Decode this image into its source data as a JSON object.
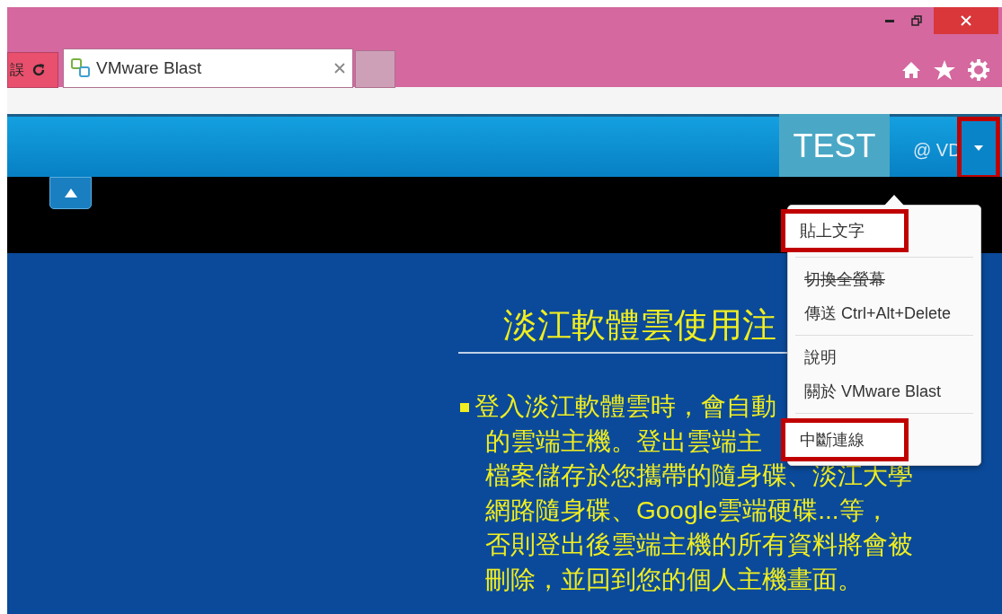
{
  "browser": {
    "address_fragment": "誤",
    "tabs": [
      {
        "title": "VMware Blast",
        "selected": true
      }
    ]
  },
  "toolbar": {
    "user": "TEST",
    "host": "@ VD",
    "dropdown_highlighted": true
  },
  "menu": {
    "groups": [
      [
        {
          "label": "貼上文字",
          "highlighted": true,
          "struck": false
        }
      ],
      [
        {
          "label": "切換全螢幕",
          "highlighted": false,
          "struck": true
        },
        {
          "label": "傳送 Ctrl+Alt+Delete",
          "highlighted": false,
          "struck": false
        }
      ],
      [
        {
          "label": "說明",
          "highlighted": false,
          "struck": false
        },
        {
          "label": "關於 VMware Blast",
          "highlighted": false,
          "struck": false
        }
      ],
      [
        {
          "label": "中斷連線",
          "highlighted": true,
          "struck": false
        }
      ]
    ]
  },
  "slide": {
    "title": "淡江軟體雲使用注",
    "bullet_lines": [
      "登入淡江軟體雲時，會自動",
      "的雲端主機。登出雲端主",
      "檔案儲存於您攜帶的隨身碟、淡江大學",
      "網路隨身碟、Google雲端硬碟...等，",
      "否則登出後雲端主機的所有資料將會被",
      "刪除，並回到您的個人主機畫面。"
    ]
  }
}
